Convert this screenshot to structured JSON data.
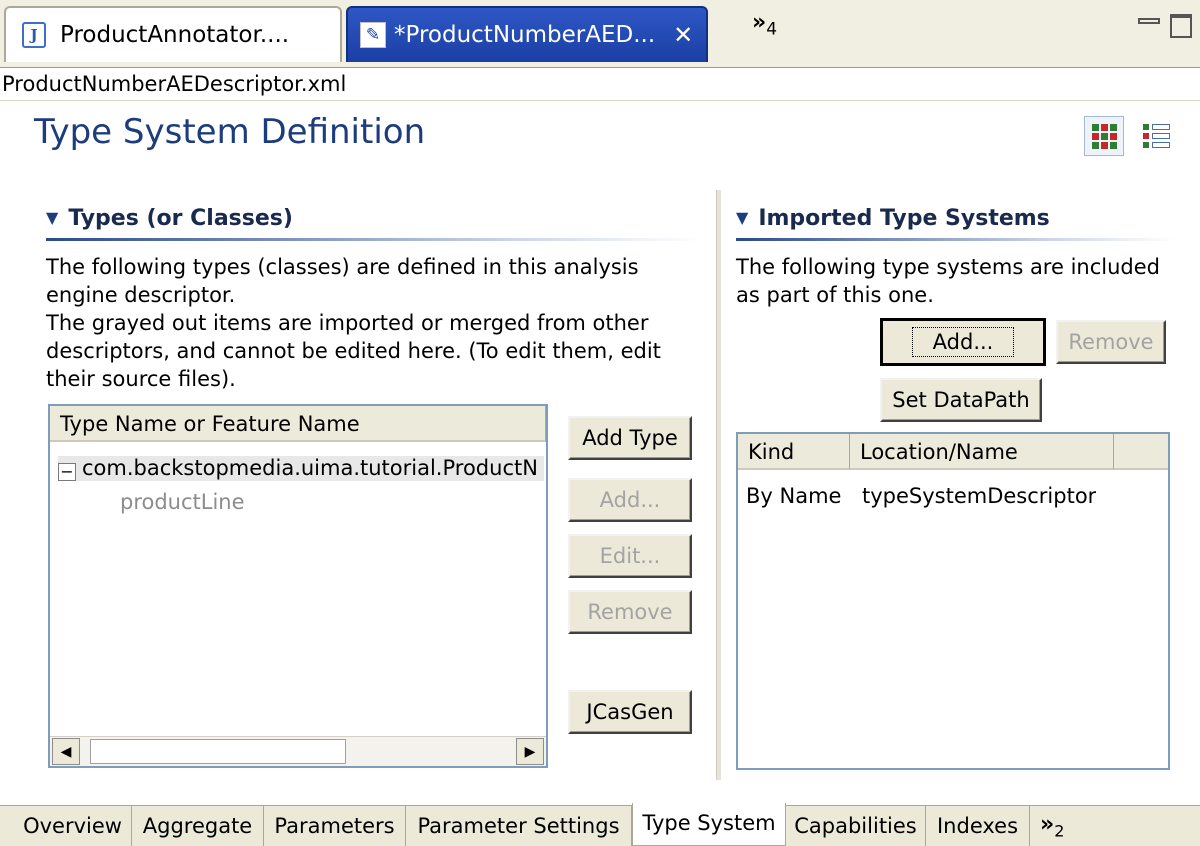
{
  "editor_tabs": [
    {
      "label": "ProductAnnotator....",
      "icon": "java-file-icon",
      "active": false
    },
    {
      "label": "*ProductNumberAED...",
      "icon": "xml-editor-icon",
      "active": true
    }
  ],
  "tab_overflow_count": "4",
  "file_name": "ProductNumberAEDescriptor.xml",
  "page_title": "Type System Definition",
  "types_section": {
    "title": "Types (or Classes)",
    "desc_lines": [
      "The following types (classes) are defined in this analysis",
      "engine descriptor.",
      "The grayed out items are imported or merged from other",
      "descriptors, and cannot be edited here. (To edit them, edit",
      "their source files)."
    ],
    "column_header": "Type Name or Feature Name",
    "tree": {
      "toggle": "−",
      "type_name": "com.backstopmedia.uima.tutorial.ProductN",
      "feature": "productLine"
    },
    "buttons": {
      "add_type": "Add Type",
      "add": "Add...",
      "edit": "Edit...",
      "remove": "Remove",
      "jcasgen": "JCasGen"
    }
  },
  "imports_section": {
    "title": "Imported Type Systems",
    "desc_lines": [
      "The following type systems are included",
      "as part of this one."
    ],
    "buttons": {
      "add": "Add...",
      "remove": "Remove",
      "set_datapath": "Set DataPath"
    },
    "columns": [
      "Kind",
      "Location/Name",
      ""
    ],
    "rows": [
      {
        "kind": "By Name",
        "location": "typeSystemDescriptor"
      }
    ]
  },
  "bottom_tabs": [
    "Overview",
    "Aggregate",
    "Parameters",
    "Parameter Settings",
    "Type System",
    "Capabilities",
    "Indexes"
  ],
  "bottom_active_tab": "Type System",
  "bottom_overflow_count": "2",
  "colors": {
    "title_blue": "#1c3c7e",
    "active_tab_blue": "#1a3fa5",
    "chrome_beige": "#ece9d8",
    "greyed_text": "#8c8c8c"
  }
}
